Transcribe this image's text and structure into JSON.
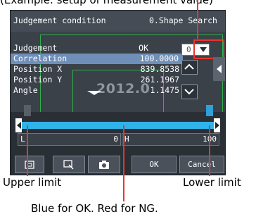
{
  "caption_top": "(Example: setup of measurement value)",
  "title_bar": {
    "left": "Judgement condition",
    "right": "0.Shape Search"
  },
  "measurements": [
    {
      "label": "Judgement",
      "value": "OK",
      "selected": false
    },
    {
      "label": "Correlation",
      "value": "100.0000",
      "selected": true
    },
    {
      "label": "Position X",
      "value": "839.8538",
      "selected": false
    },
    {
      "label": "Position Y",
      "value": "261.1967",
      "selected": false
    },
    {
      "label": "Angle",
      "value": "1.1475",
      "selected": false
    }
  ],
  "dropdown_value": "0",
  "watermark_text": "2012.0",
  "limits": {
    "lower_tag": "L",
    "lower_value": "0",
    "upper_tag": "H",
    "upper_value": "100"
  },
  "toolbar": {
    "ok_label": "OK",
    "cancel_label": "Cancel"
  },
  "callouts": {
    "left": "Upper limit",
    "right": "Lower limit",
    "bottom": "Blue for OK. Red for NG."
  },
  "colors": {
    "bar_ok": "#2fb3ea",
    "highlight": "#e8352c",
    "frame": "#2fb04a"
  }
}
